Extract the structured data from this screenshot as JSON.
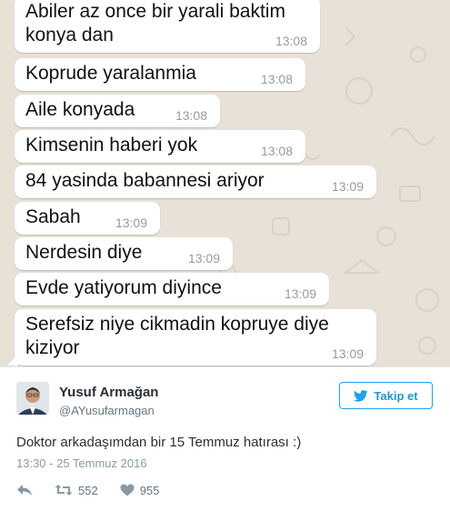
{
  "chat": {
    "messages": [
      {
        "lines": [
          "Abiler az once bir yarali baktim",
          "konya dan"
        ],
        "time": "13:08"
      },
      {
        "lines": [
          "Koprude yaralanmia"
        ],
        "time": "13:08"
      },
      {
        "lines": [
          "Aile konyada"
        ],
        "time": "13:08"
      },
      {
        "lines": [
          "Kimsenin haberi yok"
        ],
        "time": "13:08"
      },
      {
        "lines": [
          "84 yasinda babannesi ariyor"
        ],
        "time": "13:09"
      },
      {
        "lines": [
          "Sabah"
        ],
        "time": "13:09"
      },
      {
        "lines": [
          "Nerdesin diye"
        ],
        "time": "13:09"
      },
      {
        "lines": [
          "Evde yatiyorum diyince"
        ],
        "time": "13:09"
      },
      {
        "lines": [
          "Serefsiz niye cikmadin kopruye diye",
          "kiziyor"
        ],
        "time": "13:09"
      }
    ]
  },
  "tweet": {
    "display_name": "Yusuf Armağan",
    "handle": "@AYusufarmagan",
    "follow_label": "Takip et",
    "text": "Doktor arkadaşımdan bir 15 Temmuz hatırası :)",
    "date": "13:30 - 25 Temmuz 2016",
    "retweets": "552",
    "likes": "955",
    "icons": {
      "follow": "bird-icon",
      "reply": "reply-icon",
      "retweet": "retweet-icon",
      "like": "heart-icon"
    },
    "colors": {
      "accent": "#1da1f2",
      "chat_bg": "#e7e1d7"
    }
  }
}
